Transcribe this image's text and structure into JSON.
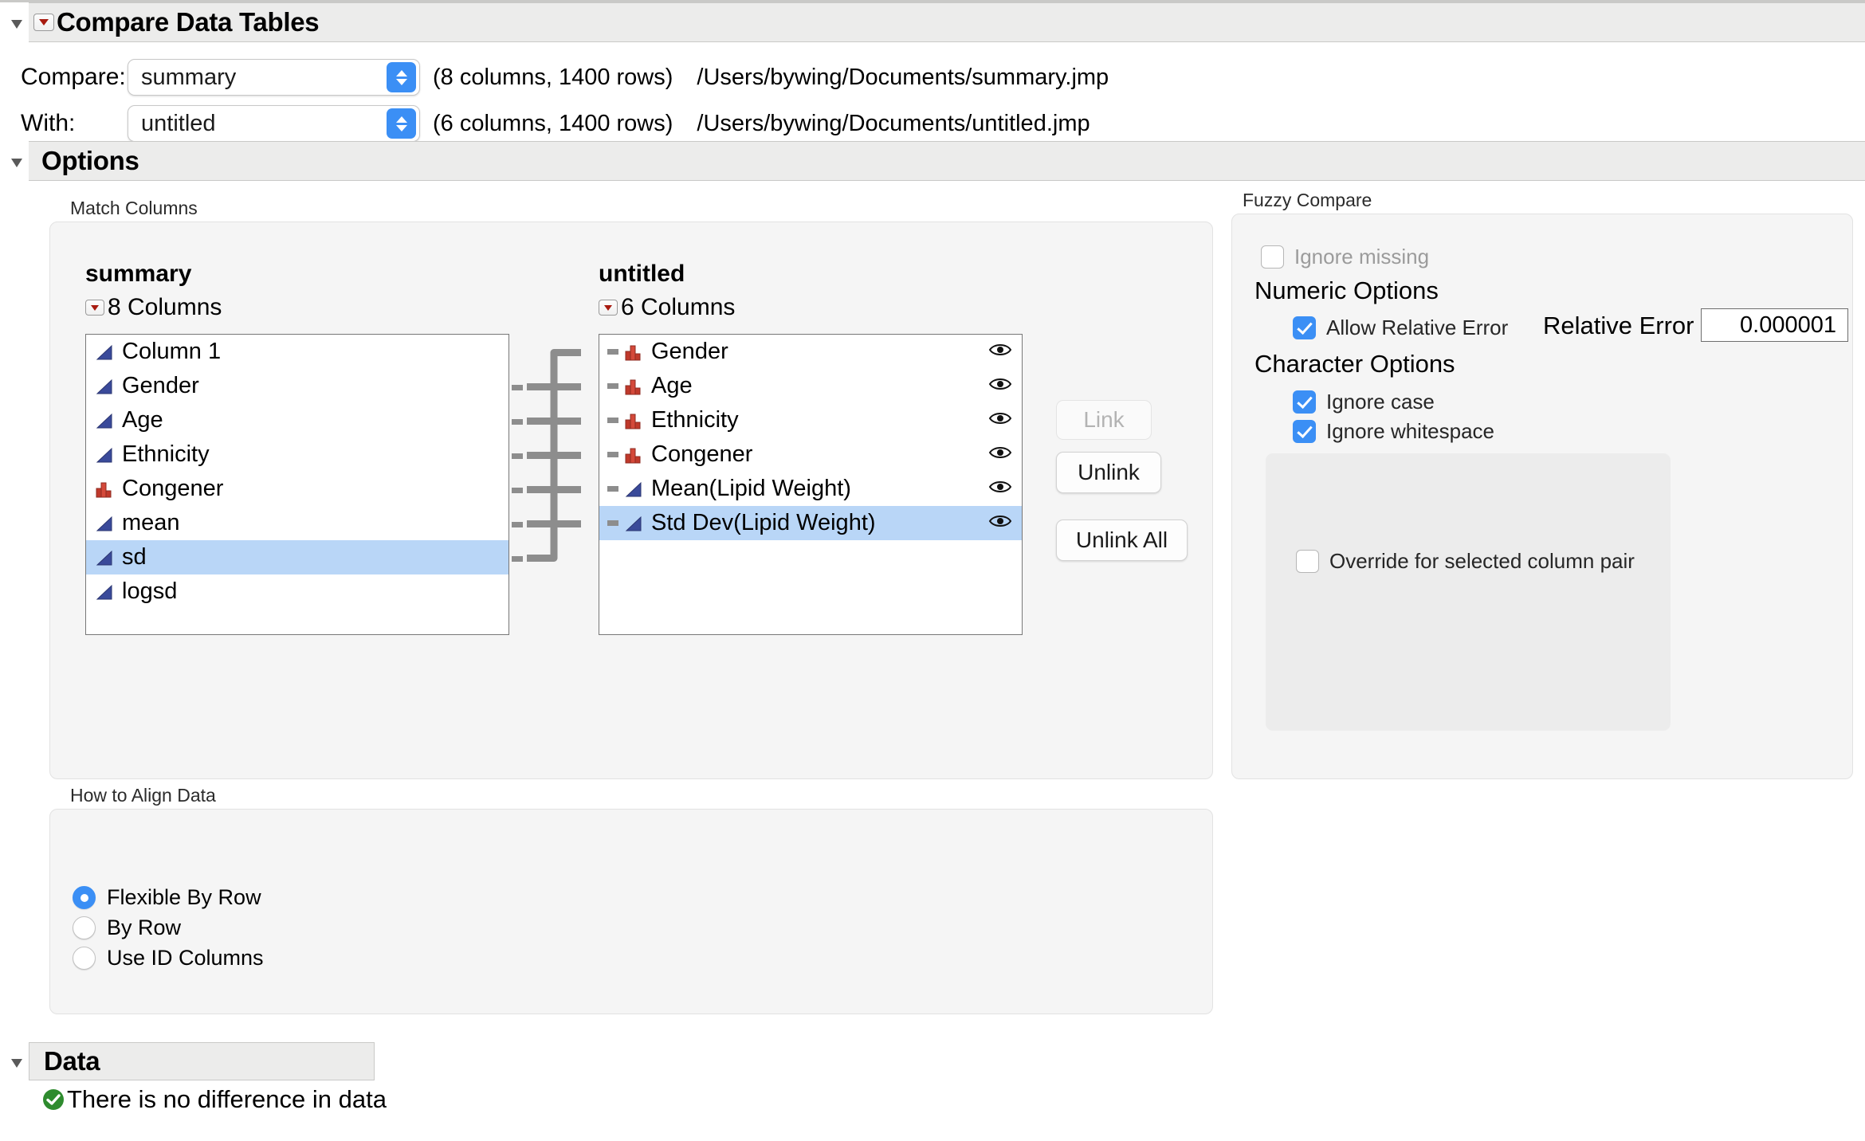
{
  "window": {
    "title": "Compare Data Tables"
  },
  "compare_row": {
    "label": "Compare:",
    "value": "summary",
    "meta": "(8 columns, 1400 rows)",
    "path": "/Users/bywing/Documents/summary.jmp"
  },
  "with_row": {
    "label": "With:",
    "value": "untitled",
    "meta": "(6 columns, 1400 rows)",
    "path": "/Users/bywing/Documents/untitled.jmp"
  },
  "options": {
    "title": "Options"
  },
  "match_columns": {
    "group_label": "Match Columns",
    "left": {
      "table_name": "summary",
      "count_label": "8 Columns",
      "columns": [
        {
          "name": "Column 1",
          "type": "continuous",
          "linked": false
        },
        {
          "name": "Gender",
          "type": "continuous",
          "linked": true
        },
        {
          "name": "Age",
          "type": "continuous",
          "linked": true
        },
        {
          "name": "Ethnicity",
          "type": "continuous",
          "linked": true
        },
        {
          "name": "Congener",
          "type": "nominal",
          "linked": true
        },
        {
          "name": "mean",
          "type": "continuous",
          "linked": true
        },
        {
          "name": "sd",
          "type": "continuous",
          "linked": true,
          "selected": true
        },
        {
          "name": "logsd",
          "type": "continuous",
          "linked": false
        }
      ]
    },
    "right": {
      "table_name": "untitled",
      "count_label": "6 Columns",
      "columns": [
        {
          "name": "Gender",
          "type": "nominal",
          "linked": true
        },
        {
          "name": "Age",
          "type": "nominal",
          "linked": true
        },
        {
          "name": "Ethnicity",
          "type": "nominal",
          "linked": true
        },
        {
          "name": "Congener",
          "type": "nominal",
          "linked": true
        },
        {
          "name": "Mean(Lipid Weight)",
          "type": "continuous",
          "linked": true
        },
        {
          "name": "Std Dev(Lipid Weight)",
          "type": "continuous",
          "linked": true,
          "selected": true
        }
      ]
    },
    "buttons": {
      "link": "Link",
      "unlink": "Unlink",
      "unlink_all": "Unlink All"
    }
  },
  "fuzzy_compare": {
    "group_label": "Fuzzy Compare",
    "ignore_missing": {
      "label": "Ignore missing",
      "checked": false
    },
    "numeric_options_title": "Numeric Options",
    "allow_relative_error": {
      "label": "Allow Relative Error",
      "checked": true
    },
    "relative_error": {
      "label": "Relative Error",
      "value": "0.000001"
    },
    "character_options_title": "Character Options",
    "ignore_case": {
      "label": "Ignore case",
      "checked": true
    },
    "ignore_whitespace": {
      "label": "Ignore whitespace",
      "checked": true
    },
    "override": {
      "label": "Override for selected column pair",
      "checked": false
    }
  },
  "align_data": {
    "group_label": "How to Align Data",
    "options": [
      {
        "label": "Flexible By Row",
        "selected": true
      },
      {
        "label": "By Row",
        "selected": false
      },
      {
        "label": "Use ID Columns",
        "selected": false
      }
    ]
  },
  "data_section": {
    "title": "Data",
    "status_message": "There is no difference in data",
    "status_icon": "check-circle-icon"
  },
  "colors": {
    "accent_blue": "#3b8ff5",
    "selection_blue": "#b9d6f7",
    "band_gray": "#ececeb",
    "nominal_red": "#c0392b",
    "continuous_blue": "#3a4a9a",
    "success_green": "#2e8b2e",
    "link_line": "#8d8d8d"
  }
}
